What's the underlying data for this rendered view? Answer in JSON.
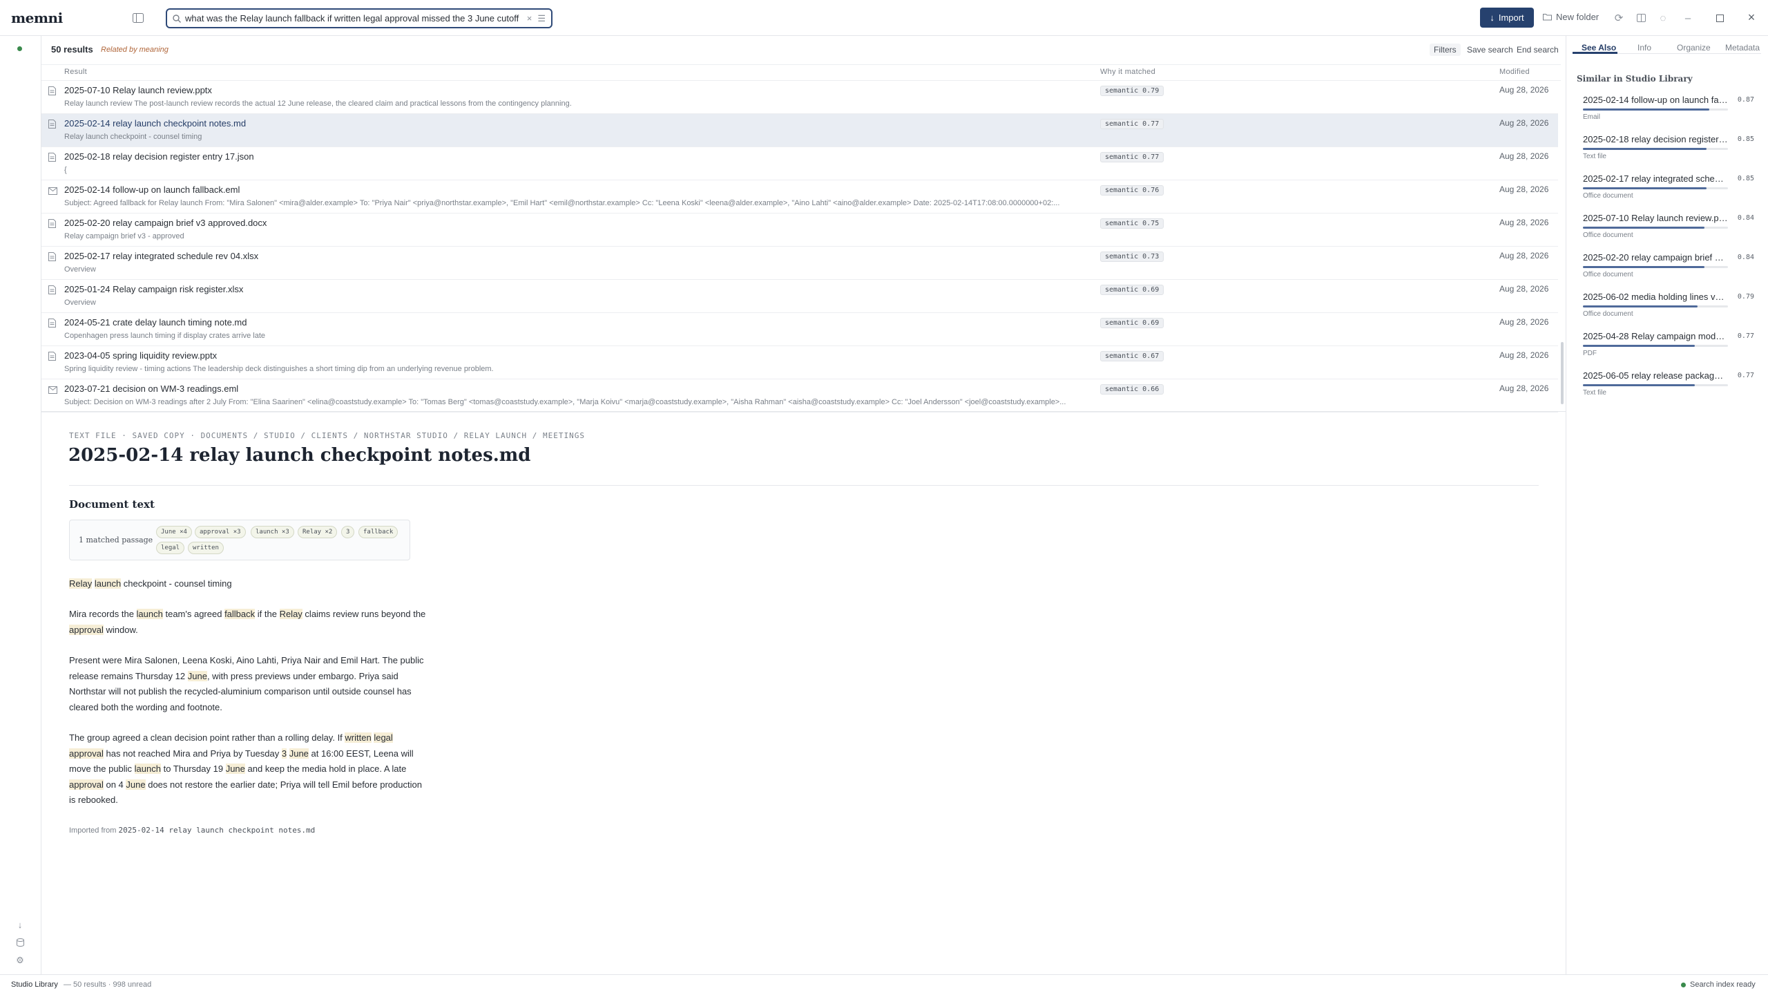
{
  "app": {
    "name": "memni"
  },
  "search": {
    "value": "what was the Relay launch fallback if written legal approval missed the 3 June cutoff"
  },
  "toolbar": {
    "import_label": "Import",
    "new_folder_label": "New folder"
  },
  "results": {
    "count_label": "50 results",
    "mode_label": "Related by meaning",
    "filters_label": "Filters",
    "save_search_label": "Save search",
    "end_search_label": "End search",
    "columns": {
      "result": "Result",
      "why": "Why it matched",
      "modified": "Modified"
    },
    "rows": [
      {
        "title": "2025-07-10 Relay launch review.pptx",
        "sub": "Relay launch review The post-launch review records the actual 12 June release, the cleared claim and practical lessons from the contingency planning.",
        "badge": "semantic 0.79",
        "modified": "Aug 28, 2026",
        "icon": "document-icon"
      },
      {
        "title": "2025-02-14 relay launch checkpoint notes.md",
        "sub": "Relay launch checkpoint - counsel timing",
        "badge": "semantic 0.77",
        "modified": "Aug 28, 2026",
        "icon": "document-icon"
      },
      {
        "title": "2025-02-18 relay decision register entry 17.json",
        "sub": "{",
        "badge": "semantic 0.77",
        "modified": "Aug 28, 2026",
        "icon": "document-icon"
      },
      {
        "title": "2025-02-14 follow-up on launch fallback.eml",
        "sub": "Subject: Agreed fallback for Relay launch From: \"Mira Salonen\" <mira@alder.example> To: \"Priya Nair\" <priya@northstar.example>, \"Emil Hart\" <emil@northstar.example> Cc: \"Leena Koski\" <leena@alder.example>, \"Aino Lahti\" <aino@alder.example> Date: 2025-02-14T17:08:00.0000000+02:...",
        "badge": "semantic 0.76",
        "modified": "Aug 28, 2026",
        "icon": "mail-icon"
      },
      {
        "title": "2025-02-20 relay campaign brief v3 approved.docx",
        "sub": "Relay campaign brief v3 - approved",
        "badge": "semantic 0.75",
        "modified": "Aug 28, 2026",
        "icon": "document-icon"
      },
      {
        "title": "2025-02-17 relay integrated schedule rev 04.xlsx",
        "sub": "Overview",
        "badge": "semantic 0.73",
        "modified": "Aug 28, 2026",
        "icon": "document-icon"
      },
      {
        "title": "2025-01-24 Relay campaign risk register.xlsx",
        "sub": "Overview",
        "badge": "semantic 0.69",
        "modified": "Aug 28, 2026",
        "icon": "document-icon"
      },
      {
        "title": "2024-05-21 crate delay launch timing note.md",
        "sub": "Copenhagen press launch timing if display crates arrive late",
        "badge": "semantic 0.69",
        "modified": "Aug 28, 2026",
        "icon": "document-icon"
      },
      {
        "title": "2023-04-05 spring liquidity review.pptx",
        "sub": "Spring liquidity review - timing actions The leadership deck distinguishes a short timing dip from an underlying revenue problem.",
        "badge": "semantic 0.67",
        "modified": "Aug 28, 2026",
        "icon": "document-icon"
      },
      {
        "title": "2023-07-21 decision on WM-3 readings.eml",
        "sub": "Subject: Decision on WM-3 readings after 2 July From: \"Elina Saarinen\" <elina@coaststudy.example> To: \"Tomas Berg\" <tomas@coaststudy.example>, \"Marja Koivu\" <marja@coaststudy.example>, \"Aisha Rahman\" <aisha@coaststudy.example> Cc: \"Joel Andersson\" <joel@coaststudy.example>...",
        "badge": "semantic 0.66",
        "modified": "Aug 28, 2026",
        "icon": "mail-icon"
      }
    ]
  },
  "document": {
    "breadcrumb": "TEXT FILE · SAVED COPY · DOCUMENTS / STUDIO / CLIENTS / NORTHSTAR STUDIO / RELAY LAUNCH / MEETINGS",
    "title": "2025-02-14 relay launch checkpoint notes.md",
    "section_heading": "Document text",
    "matched_label": "1 matched passage",
    "chips": [
      "June ×4",
      "approval ×3",
      "launch ×3",
      "Relay ×2",
      "3",
      "fallback",
      "legal",
      "written"
    ],
    "imported_prefix": "Imported from",
    "imported_file": "2025-02-14 relay launch checkpoint notes.md"
  },
  "right_panel": {
    "tabs": [
      "See Also",
      "Info",
      "Organize",
      "Metadata"
    ],
    "active_tab": "See Also",
    "heading": "Similar in Studio Library",
    "items": [
      {
        "title": "2025-02-14 follow-up on launch fall...",
        "score": "0.87",
        "score_value": 0.87,
        "kind": "Email"
      },
      {
        "title": "2025-02-18 relay decision register e...",
        "score": "0.85",
        "score_value": 0.85,
        "kind": "Text file"
      },
      {
        "title": "2025-02-17 relay integrated schedul...",
        "score": "0.85",
        "score_value": 0.85,
        "kind": "Office document"
      },
      {
        "title": "2025-07-10 Relay launch review.pptx",
        "score": "0.84",
        "score_value": 0.84,
        "kind": "Office document"
      },
      {
        "title": "2025-02-20 relay campaign brief v3 ...",
        "score": "0.84",
        "score_value": 0.84,
        "kind": "Office document"
      },
      {
        "title": "2025-06-02 media holding lines v2.rtf",
        "score": "0.79",
        "score_value": 0.79,
        "kind": "Office document"
      },
      {
        "title": "2025-04-28 Relay campaign model a...",
        "score": "0.77",
        "score_value": 0.77,
        "kind": "PDF"
      },
      {
        "title": "2025-06-05 relay release package ch...",
        "score": "0.77",
        "score_value": 0.77,
        "kind": "Text file"
      }
    ]
  },
  "status": {
    "left": "Studio Library",
    "right_counts": "— 50 results · 998 unread",
    "index": "Search index ready"
  },
  "colors": {
    "accent": "#26416e",
    "highlight": "#f6eed6",
    "ready": "#3a8a4c"
  }
}
